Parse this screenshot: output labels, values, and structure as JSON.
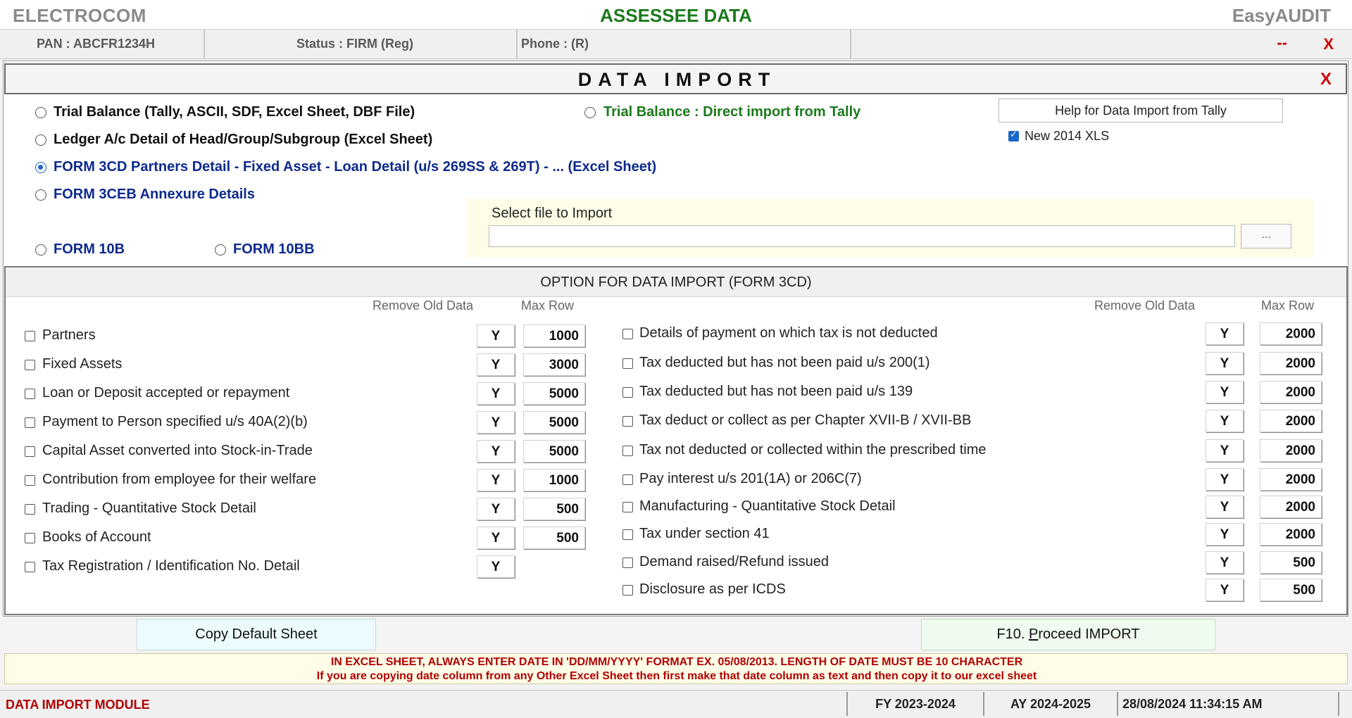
{
  "titlebar": {
    "app_name": "ELECTROCOM",
    "window_title": "ASSESSEE DATA",
    "brand": "EasyAUDIT"
  },
  "infobar": {
    "pan": "PAN  :  ABCFR1234H",
    "status": "Status  :  FIRM (Reg)",
    "phone": "Phone  : (R)",
    "minimize": "--",
    "close": "X"
  },
  "panel": {
    "title": "DATA IMPORT",
    "close": "X"
  },
  "import_options": {
    "trial_balance": "Trial Balance (Tally, ASCII, SDF, Excel Sheet, DBF File)",
    "trial_balance_tally": "Trial Balance : Direct import from Tally",
    "ledger": "Ledger A/c Detail of Head/Group/Subgroup (Excel Sheet)",
    "form3cd": "FORM 3CD Partners Detail - Fixed Asset - Loan Detail (u/s 269SS & 269T) - ... (Excel Sheet)",
    "form3ceb": "FORM 3CEB Annexure Details",
    "form10b": "FORM 10B",
    "form10bb": "FORM 10BB",
    "selected": "form3cd"
  },
  "help_button": "Help for Data Import from Tally",
  "new_xls": {
    "label": "New 2014 XLS",
    "checked": true
  },
  "file_select": {
    "label": "Select file to Import",
    "value": "",
    "browse": "..."
  },
  "options": {
    "title": "OPTION FOR DATA IMPORT (FORM 3CD)",
    "col_remove": "Remove Old Data",
    "col_max": "Max Row",
    "left": [
      {
        "label": "Partners",
        "remove": "Y",
        "max": "1000"
      },
      {
        "label": "Fixed Assets",
        "remove": "Y",
        "max": "3000"
      },
      {
        "label": "Loan or Deposit accepted or repayment",
        "remove": "Y",
        "max": "5000"
      },
      {
        "label": "Payment to Person specified u/s 40A(2)(b)",
        "remove": "Y",
        "max": "5000"
      },
      {
        "label": "Capital Asset converted into Stock-in-Trade",
        "remove": "Y",
        "max": "5000"
      },
      {
        "label": "Contribution from employee for their welfare",
        "remove": "Y",
        "max": "1000"
      },
      {
        "label": "Trading - Quantitative Stock Detail",
        "remove": "Y",
        "max": "500"
      },
      {
        "label": "Books of Account",
        "remove": "Y",
        "max": "500"
      },
      {
        "label": "Tax Registration / Identification No. Detail",
        "remove": "Y",
        "max": ""
      }
    ],
    "right": [
      {
        "label": "Details of payment on which tax is not deducted",
        "remove": "Y",
        "max": "2000"
      },
      {
        "label": "Tax deducted but has not been paid u/s 200(1)",
        "remove": "Y",
        "max": "2000"
      },
      {
        "label": "Tax deducted but has not been paid u/s 139",
        "remove": "Y",
        "max": "2000"
      },
      {
        "label": "Tax deduct or collect as per Chapter XVII-B / XVII-BB",
        "remove": "Y",
        "max": "2000"
      },
      {
        "label": "Tax not deducted or collected within the prescribed time",
        "remove": "Y",
        "max": "2000"
      },
      {
        "label": "Pay interest u/s 201(1A) or 206C(7)",
        "remove": "Y",
        "max": "2000"
      },
      {
        "label": "Manufacturing - Quantitative Stock Detail",
        "remove": "Y",
        "max": "2000"
      },
      {
        "label": "Tax under section 41",
        "remove": "Y",
        "max": "2000"
      },
      {
        "label": "Demand raised/Refund issued",
        "remove": "Y",
        "max": "500"
      },
      {
        "label": "Disclosure as per ICDS",
        "remove": "Y",
        "max": "500"
      }
    ]
  },
  "buttons": {
    "copy_default": "Copy Default Sheet",
    "proceed_prefix": "F10. ",
    "proceed_underlined": "P",
    "proceed_rest": "roceed IMPORT"
  },
  "notes": {
    "line1": "IN EXCEL SHEET, ALWAYS ENTER DATE IN 'DD/MM/YYYY' FORMAT  EX. 05/08/2013. LENGTH OF DATE MUST BE 10 CHARACTER",
    "line2": "If you are copying date column from any Other Excel Sheet then first make that date column as text and then copy it to our excel sheet"
  },
  "statusbar": {
    "module": "DATA IMPORT MODULE",
    "fy": "FY 2023-2024",
    "ay": "AY 2024-2025",
    "datetime": "28/08/2024 11:34:15 AM"
  },
  "colors": {
    "brand_green": "#1c7a1c",
    "accent_blue": "#0d2a8c",
    "alert_red": "#b00000"
  }
}
